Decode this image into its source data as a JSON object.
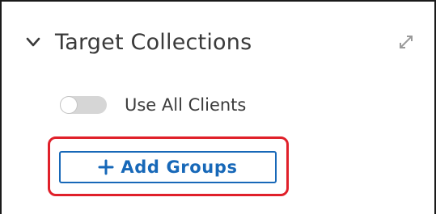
{
  "section": {
    "title": "Target Collections",
    "collapse_icon": "chevron-down-icon",
    "expand_icon": "expand-diagonal-icon"
  },
  "toggle": {
    "label": "Use All Clients",
    "on": false
  },
  "add_button": {
    "icon": "plus-icon",
    "label": "Add Groups"
  },
  "colors": {
    "accent": "#1768b8",
    "highlight": "#e0202a",
    "toggle_off": "#d6d6d6",
    "text": "#3a3a3a"
  }
}
